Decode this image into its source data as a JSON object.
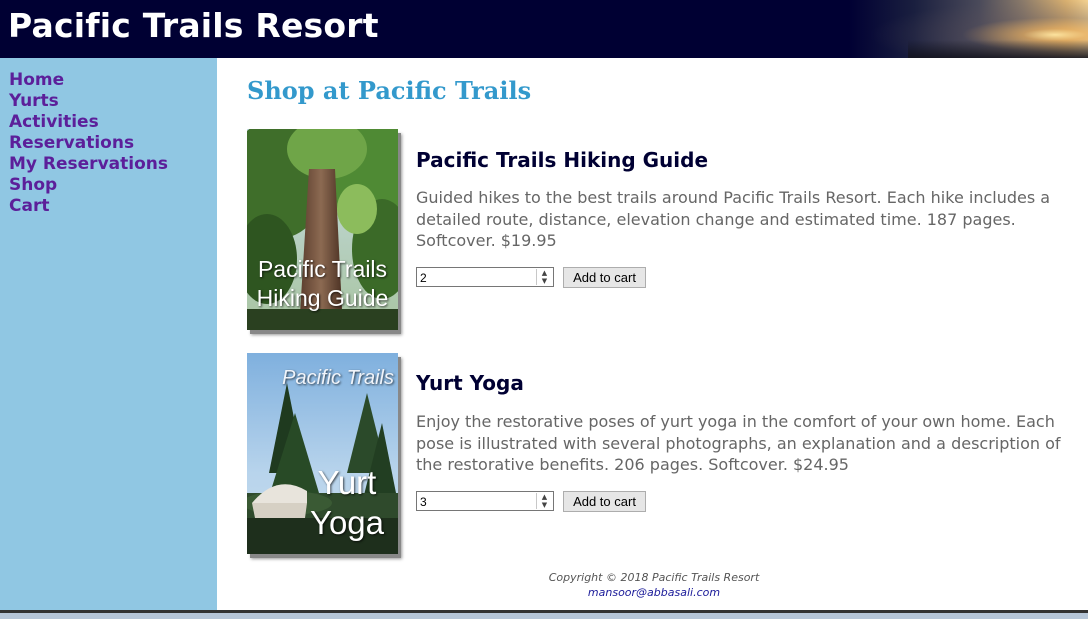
{
  "header": {
    "site_title": "Pacific Trails Resort"
  },
  "nav": {
    "items": [
      {
        "label": "Home"
      },
      {
        "label": "Yurts"
      },
      {
        "label": "Activities"
      },
      {
        "label": "Reservations"
      },
      {
        "label": "My Reservations"
      },
      {
        "label": "Shop"
      },
      {
        "label": "Cart"
      }
    ]
  },
  "main": {
    "heading": "Shop at Pacific Trails",
    "products": [
      {
        "cover_text_line1": "Pacific Trails",
        "cover_text_line2": "Hiking Guide",
        "title": "Pacific Trails Hiking Guide",
        "description": "Guided hikes to the best trails around Pacific Trails Resort. Each hike includes a detailed route, distance, elevation change and estimated time. 187 pages. Softcover. $19.95",
        "quantity": "2",
        "button_label": "Add to cart"
      },
      {
        "cover_text_line1": "Pacific Trails",
        "cover_text_line2": "Yurt",
        "cover_text_line3": "Yoga",
        "title": "Yurt Yoga",
        "description": "Enjoy the restorative poses of yurt yoga in the comfort of your own home. Each pose is illustrated with several photographs, an explanation and a description of the restorative benefits. 206 pages. Softcover. $24.95",
        "quantity": "3",
        "button_label": "Add to cart"
      }
    ]
  },
  "footer": {
    "copyright": "Copyright © 2018 Pacific Trails Resort",
    "email": "mansoor@abbasali.com"
  },
  "colors": {
    "header_bg": "#000033",
    "nav_bg": "#90c7e3",
    "nav_link": "#5c1f9a",
    "heading": "#3399cc",
    "product_title": "#000033",
    "body_text": "#666666"
  }
}
